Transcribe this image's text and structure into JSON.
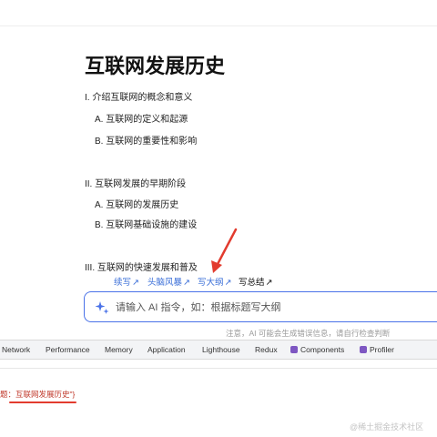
{
  "document": {
    "title": "互联网发展历史",
    "outline": [
      {
        "text": "I. 介绍互联网的概念和意义",
        "level": 1
      },
      {
        "text": "A. 互联网的定义和起源",
        "level": 2
      },
      {
        "text": "B. 互联网的重要性和影响",
        "level": 2
      },
      {
        "text": "II. 互联网发展的早期阶段",
        "level": 1
      },
      {
        "text": "A. 互联网的发展历史",
        "level": 2
      },
      {
        "text": "B. 互联网基础设施的建设",
        "level": 2
      },
      {
        "text": "III. 互联网的快速发展和普及",
        "level": 1
      }
    ]
  },
  "ai": {
    "suggestions": [
      {
        "label": "续写",
        "arrow": "↗"
      },
      {
        "label": "头脑风暴",
        "arrow": "↗"
      },
      {
        "label": "写大纲",
        "arrow": "↗"
      },
      {
        "label": "写总结",
        "arrow": "↗"
      }
    ],
    "input_placeholder": "请输入 AI 指令，如：根据标题写大纲",
    "disclaimer": "注意，AI 可能会生成错误信息，请自行检查判断"
  },
  "devtools": {
    "tabs": [
      {
        "label": "Network"
      },
      {
        "label": "Performance"
      },
      {
        "label": "Memory"
      },
      {
        "label": "Application"
      },
      {
        "label": "Lighthouse"
      },
      {
        "label": "Redux"
      },
      {
        "label": "Components"
      },
      {
        "label": "Profiler"
      }
    ],
    "console_line": "题：互联网发展历史\"}"
  },
  "watermark": "@稀土掘金技术社区",
  "colors": {
    "accent": "#4a72e8",
    "link": "#3b6fd8",
    "annotation_red": "#e23b2e",
    "react_badge": "#7e57c2"
  },
  "icons": {
    "ai_input": "sparkle-icon",
    "suggestion_arrow": "arrow-up-right-icon",
    "react_tabs": "react-devtools-icon"
  }
}
